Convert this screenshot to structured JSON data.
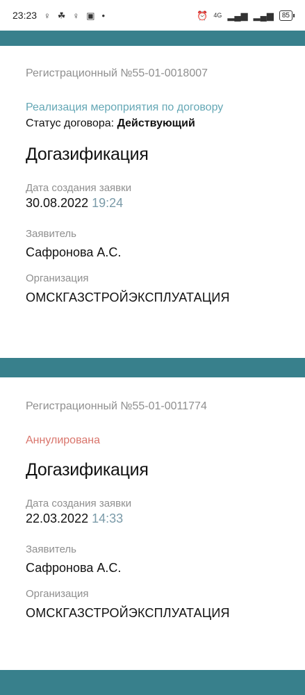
{
  "status_bar": {
    "time": "23:23",
    "network": "4G",
    "battery": "85"
  },
  "applications": [
    {
      "registration": "Регистрационный №55-01-0018007",
      "phase": "Реализация мероприятия по договору",
      "status_label": "Статус договора:",
      "status_value": "Действующий",
      "service": "Догазификация",
      "date_label": "Дата создания заявки",
      "date": "30.08.2022",
      "time": "19:24",
      "applicant_label": "Заявитель",
      "applicant": "Сафронова А.С.",
      "org_label": "Организация",
      "org": "ОМСКГАЗСТРОЙЭКСПЛУАТАЦИЯ"
    },
    {
      "registration": "Регистрационный №55-01-0011774",
      "status": "Аннулирована",
      "service": "Догазификация",
      "date_label": "Дата создания заявки",
      "date": "22.03.2022",
      "time": "14:33",
      "applicant_label": "Заявитель",
      "applicant": "Сафронова А.С.",
      "org_label": "Организация",
      "org": "ОМСКГАЗСТРОЙЭКСПЛУАТАЦИЯ"
    }
  ]
}
